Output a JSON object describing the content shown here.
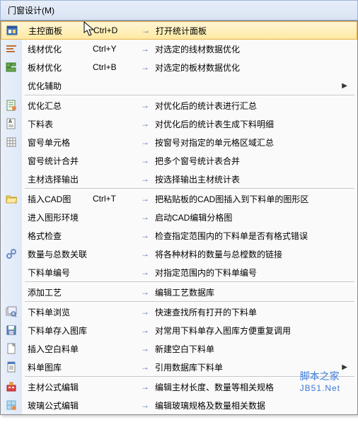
{
  "menubar": {
    "title": "门窗设计(M)",
    "accel": "M"
  },
  "items": [
    {
      "icon": "panel",
      "label": "主控面板",
      "shortcut": "Ctrl+D",
      "desc": "打开统计面板",
      "sel": true
    },
    {
      "icon": "line-opt",
      "label": "线材优化",
      "shortcut": "Ctrl+Y",
      "desc": "对选定的线材数据优化"
    },
    {
      "icon": "board-opt",
      "label": "板材优化",
      "shortcut": "Ctrl+B",
      "desc": "对选定的板材数据优化"
    },
    {
      "icon": "",
      "label": "优化辅助",
      "shortcut": "",
      "desc": "",
      "submenu": true
    },
    {
      "sep": true
    },
    {
      "icon": "sheet",
      "label": "优化汇总",
      "shortcut": "",
      "desc": "对优化后的统计表进行汇总"
    },
    {
      "icon": "cut-list",
      "label": "下料表",
      "shortcut": "",
      "desc": "对优化后的统计表生成下料明细"
    },
    {
      "icon": "grid",
      "label": "窗号单元格",
      "shortcut": "",
      "desc": "按窗号对指定的单元格区域汇总"
    },
    {
      "icon": "",
      "label": "窗号统计合并",
      "shortcut": "",
      "desc": "把多个窗号统计表合并"
    },
    {
      "icon": "",
      "label": "主材选择输出",
      "shortcut": "",
      "desc": "按选择输出主材统计表"
    },
    {
      "sep": true
    },
    {
      "icon": "folder",
      "label": "插入CAD图",
      "shortcut": "Ctrl+T",
      "desc": "把粘贴板的CAD图插入到下料单的图形区"
    },
    {
      "icon": "",
      "label": "进入图形环境",
      "shortcut": "",
      "desc": "启动CAD编辑分格图"
    },
    {
      "icon": "",
      "label": "格式检查",
      "shortcut": "",
      "desc": "检查指定范围内的下料单是否有格式错误"
    },
    {
      "icon": "link",
      "label": "数量与总数关联",
      "shortcut": "",
      "desc": "将各种材料的数量与总樘数的链接"
    },
    {
      "icon": "",
      "label": "下料单编号",
      "shortcut": "",
      "desc": "对指定范围内的下料单编号"
    },
    {
      "sep": true
    },
    {
      "icon": "",
      "label": "添加工艺",
      "shortcut": "",
      "desc": "编辑工艺数据库"
    },
    {
      "sep": true
    },
    {
      "icon": "browse",
      "label": "下料单浏览",
      "shortcut": "",
      "desc": "快速查找所有打开的下料单"
    },
    {
      "icon": "save-lib",
      "label": "下料单存入图库",
      "shortcut": "",
      "desc": "对常用下料单存入图库方便重复调用"
    },
    {
      "icon": "blank",
      "label": "插入空白料单",
      "shortcut": "",
      "desc": "新建空白下料单"
    },
    {
      "icon": "db",
      "label": "料单图库",
      "shortcut": "",
      "desc": "引用数据库下料单",
      "submenu": true
    },
    {
      "sep": true
    },
    {
      "icon": "formula",
      "label": "主材公式编辑",
      "shortcut": "",
      "desc": "编辑主材长度、数量等相关规格"
    },
    {
      "icon": "glass",
      "label": "玻璃公式编辑",
      "shortcut": "",
      "desc": "编辑玻璃规格及数量相关数据"
    }
  ],
  "arrow": "→",
  "watermark": {
    "cn": "脚本之家",
    "en": "JB51.Net"
  }
}
